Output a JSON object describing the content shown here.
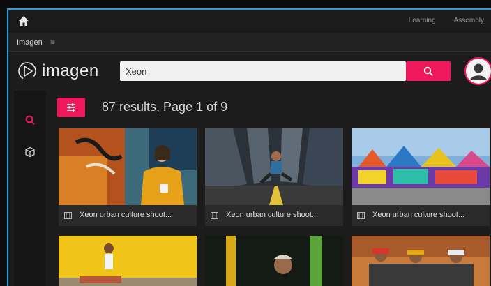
{
  "topnav": {
    "links": [
      "Learning",
      "Assembly"
    ]
  },
  "breadcrumb": {
    "label": "Imagen",
    "menu_glyph": "≡"
  },
  "brand": {
    "name": "imagen"
  },
  "search": {
    "value": "Xeon"
  },
  "results": {
    "summary": "87 results, Page 1 of 9"
  },
  "cards": [
    {
      "caption": "Xeon urban culture shoot..."
    },
    {
      "caption": "Xeon urban culture shoot..."
    },
    {
      "caption": "Xeon urban culture shoot..."
    }
  ],
  "colors": {
    "accent": "#f0185c",
    "frame": "#2aa0d6",
    "background": "#1c1c1c"
  }
}
